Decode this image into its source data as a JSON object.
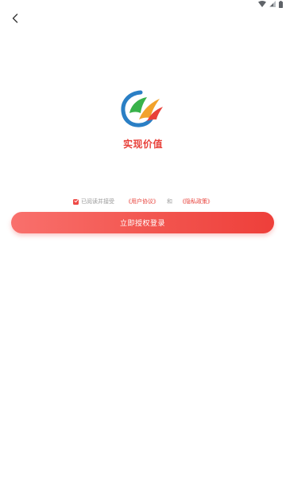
{
  "status_bar": {
    "icons": [
      "wifi-icon",
      "signal-icon",
      "battery-icon"
    ]
  },
  "nav": {
    "back_icon": "chevron-left-icon"
  },
  "logo": {
    "icon": "app-logo",
    "colors": [
      "#2a7fc5",
      "#39b24a",
      "#f2a22b",
      "#e8413a"
    ]
  },
  "app_name": "实现价值",
  "agreement": {
    "checked": true,
    "prefix_text": "已阅读并接受",
    "user_agreement_link": "《用户协议》",
    "and_text": "和",
    "privacy_policy_link": "《隐私政策》"
  },
  "login_button": {
    "label": "立即授权登录"
  },
  "colors": {
    "accent": "#e8413a",
    "muted_text": "#9a9a9a",
    "background": "#ffffff"
  }
}
